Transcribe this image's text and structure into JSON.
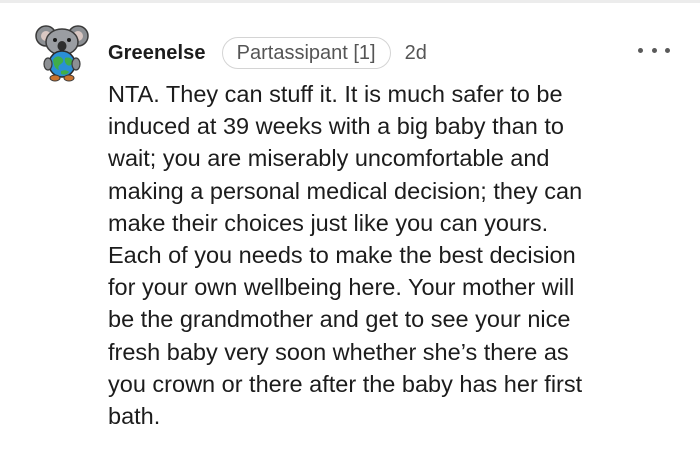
{
  "comment": {
    "avatar_icon": "koala-avatar-icon",
    "username": "Greenelse",
    "flair": "Partassipant [1]",
    "age": "2d",
    "more_icon": "more-options-icon",
    "body": "NTA. They can stuff it. It is much safer to be\ninduced at 39 weeks with a big baby than to\nwait; you are miserably uncomfortable and\nmaking a personal medical decision; they can\nmake their choices just like you can yours.\nEach of you needs to make the best decision\nfor your own wellbeing here. Your mother will\nbe the grandmother and get to see your nice\nfresh baby very soon whether she’s there as\nyou crown or there after the baby has her first\nbath."
  }
}
